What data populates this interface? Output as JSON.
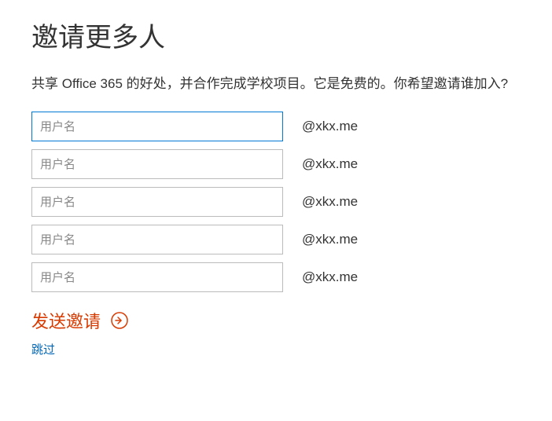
{
  "heading": "邀请更多人",
  "description": "共享 Office 365 的好处，并合作完成学校项目。它是免费的。你希望邀请谁加入?",
  "input_placeholder": "用户名",
  "domain_suffix": "@xkx.me",
  "rows": [
    {
      "placeholder": "用户名",
      "suffix": "@xkx.me",
      "focused": true
    },
    {
      "placeholder": "用户名",
      "suffix": "@xkx.me",
      "focused": false
    },
    {
      "placeholder": "用户名",
      "suffix": "@xkx.me",
      "focused": false
    },
    {
      "placeholder": "用户名",
      "suffix": "@xkx.me",
      "focused": false
    },
    {
      "placeholder": "用户名",
      "suffix": "@xkx.me",
      "focused": false
    }
  ],
  "actions": {
    "send_invite_label": "发送邀请",
    "skip_label": "跳过"
  },
  "colors": {
    "accent": "#d83b01",
    "link": "#0067b8",
    "focus_border": "#0078d4"
  }
}
